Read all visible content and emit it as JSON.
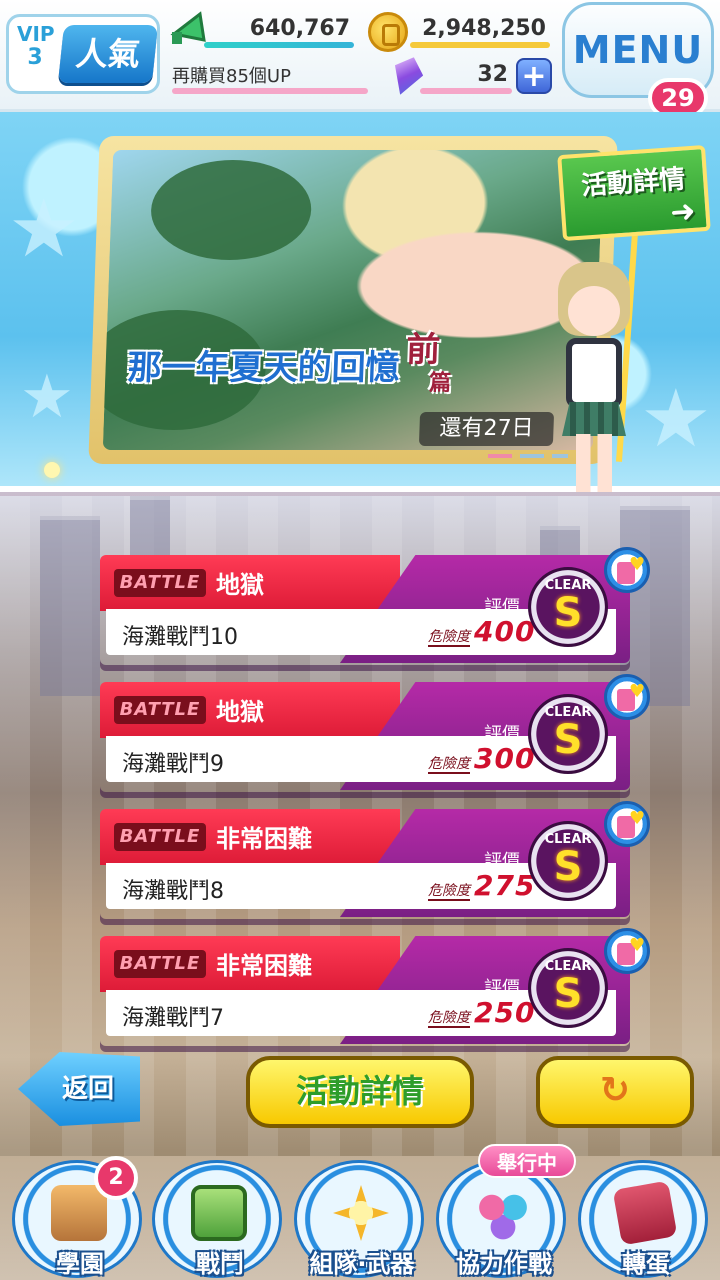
{
  "top_bar": {
    "vip_label": "VIP",
    "vip_level": "3",
    "rank_label": "人氣",
    "fans_count": "640,767",
    "coin_count": "2,948,250",
    "purchase_note": "再購買85個UP",
    "gem_count": "32",
    "plus_label": "+",
    "menu_label": "MENU",
    "menu_badge": "29"
  },
  "banner": {
    "title": "那一年夏天的回憶",
    "part": "前",
    "part_suffix": "篇",
    "days_left": "還有27日",
    "detail_sign": "活動詳情",
    "detail_arrow": "➜"
  },
  "battles": [
    {
      "tag": "BATTLE",
      "difficulty": "地獄",
      "name": "海灘戰鬥10",
      "rating_label": "評價",
      "danger_label": "危險度",
      "danger_value": "400",
      "clear_label": "CLEAR",
      "grade": "S"
    },
    {
      "tag": "BATTLE",
      "difficulty": "地獄",
      "name": "海灘戰鬥9",
      "rating_label": "評價",
      "danger_label": "危險度",
      "danger_value": "300",
      "clear_label": "CLEAR",
      "grade": "S"
    },
    {
      "tag": "BATTLE",
      "difficulty": "非常困難",
      "name": "海灘戰鬥8",
      "rating_label": "評價",
      "danger_label": "危險度",
      "danger_value": "275",
      "clear_label": "CLEAR",
      "grade": "S"
    },
    {
      "tag": "BATTLE",
      "difficulty": "非常困難",
      "name": "海灘戰鬥7",
      "rating_label": "評價",
      "danger_label": "危險度",
      "danger_value": "250",
      "clear_label": "CLEAR",
      "grade": "S"
    }
  ],
  "actions": {
    "back_label": "返回",
    "event_detail_label": "活動詳情",
    "refresh_label": "↻"
  },
  "nav": {
    "items": [
      {
        "label": "學園",
        "icon": "academy-icon"
      },
      {
        "label": "戰鬥",
        "icon": "battle-icon"
      },
      {
        "label": "組隊·武器",
        "icon": "team-weapon-icon"
      },
      {
        "label": "協力作戰",
        "icon": "coop-icon"
      },
      {
        "label": "轉蛋",
        "icon": "gacha-icon"
      }
    ],
    "academy_badge": "2",
    "event_tag": "舉行中"
  }
}
